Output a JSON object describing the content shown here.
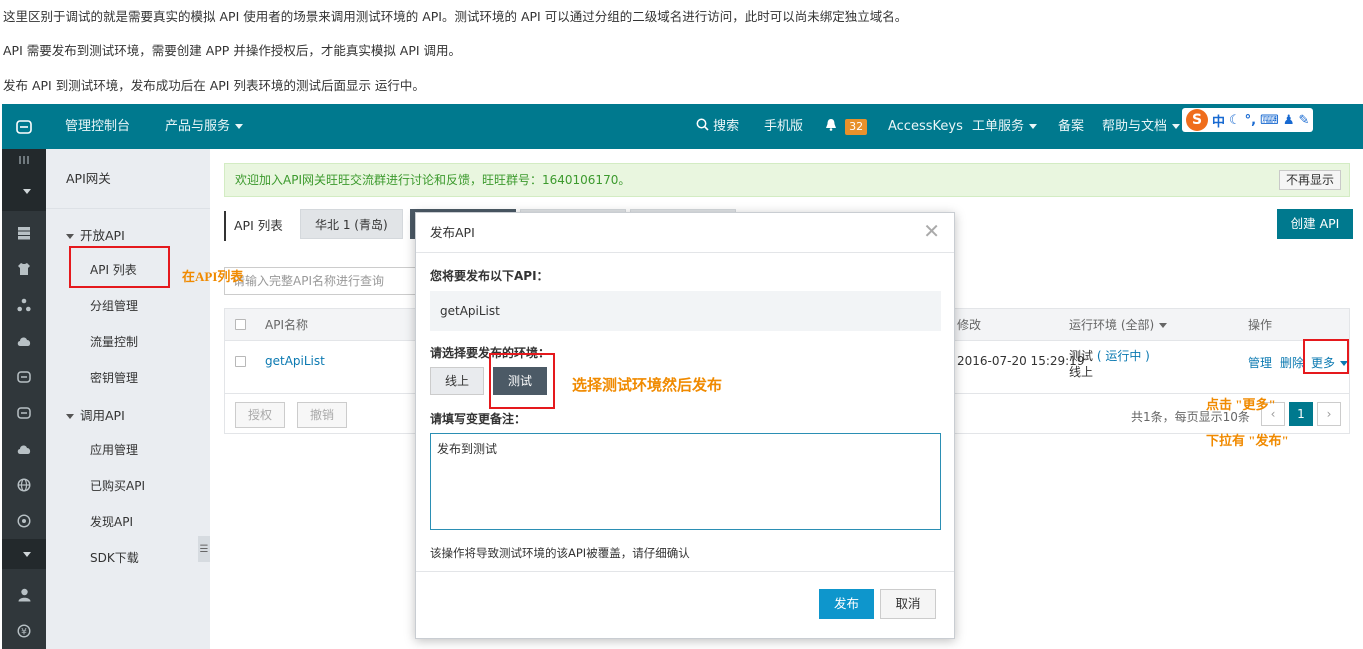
{
  "doc": {
    "line1": "这里区别于调试的就是需要真实的模拟 API 使用者的场景来调用测试环境的 API。测试环境的 API 可以通过分组的二级域名进行访问，此时可以尚未绑定独立域名。",
    "line2": "API 需要发布到测试环境，需要创建 APP 并操作授权后，才能真实模拟 API 调用。",
    "line3": "发布 API 到测试环境，发布成功后在 API 列表环境的测试后面显示 运行中。"
  },
  "topbar": {
    "console": "管理控制台",
    "products": "产品与服务",
    "search": "搜索",
    "mobile": "手机版",
    "notif_count": "32",
    "accesskeys": "AccessKeys",
    "tickets": "工单服务",
    "record": "备案",
    "help": "帮助与文档",
    "ime_mode": "中"
  },
  "sidebar": {
    "header": "API网关",
    "group_open": "开放API",
    "items_open": [
      "API 列表",
      "分组管理",
      "流量控制",
      "密钥管理"
    ],
    "group_call": "调用API",
    "items_call": [
      "应用管理",
      "已购买API",
      "发现API",
      "SDK下载"
    ]
  },
  "main": {
    "notice": "欢迎加入API网关旺旺交流群进行讨论和反馈，旺旺群号：1640106170。",
    "notice_dismiss": "不再显示",
    "tab_title": "API 列表",
    "region": "华北 1 (青岛)",
    "create": "创建 API",
    "search_placeholder": "请输入完整API名称进行查询",
    "columns": {
      "name": "API名称",
      "modified": "修改",
      "env": "运行环境 (全部)",
      "ops": "操作"
    },
    "row": {
      "name": "getApiList",
      "modified_time": "2016-07-20 15:29:19",
      "env_test": "测试",
      "env_test_status": "( 运行中 )",
      "env_online": "线上",
      "op_manage": "管理",
      "op_delete": "删除",
      "op_more": "更多"
    },
    "btn_authorize": "授权",
    "btn_unpublish": "撤销",
    "pagination_text": "共1条，每页显示10条",
    "page_current": "1"
  },
  "modal": {
    "title": "发布API",
    "label_api": "您将要发布以下API：",
    "api_name": "getApiList",
    "label_env": "请选择要发布的环境：",
    "env_online": "线上",
    "env_test": "测试",
    "label_note": "请填写变更备注：",
    "note_value": "发布到测试",
    "warning": "该操作将导致测试环境的该API被覆盖，请仔细确认",
    "publish": "发布",
    "cancel": "取消"
  },
  "annotations": {
    "api_list_hint": "在API列表",
    "choose_env": "选择测试环境然后发布",
    "click_more": "点击 \"更多\"",
    "select_publish": "下拉有 \"发布\""
  }
}
